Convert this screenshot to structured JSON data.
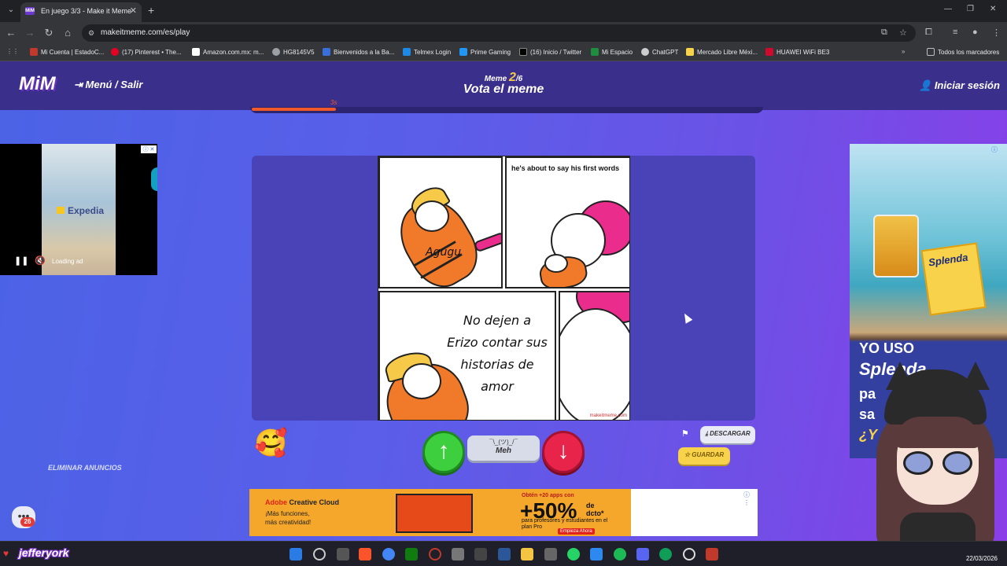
{
  "browser": {
    "tab_title": "En juego 3/3 - Make it Meme",
    "favicon_text": "MIM",
    "url": "makeitmeme.com/es/play",
    "bookmarks": [
      "Mi Cuenta | EstadoC...",
      "(17) Pinterest • The...",
      "Amazon.com.mx: m...",
      "HG8145V5",
      "Bienvenidos a la Ba...",
      "Telmex Login",
      "Prime Gaming",
      "(16) Inicio / Twitter",
      "Mi Espacio",
      "ChatGPT",
      "Mercado Libre Méxi...",
      "HUAWEI WiFi BE3"
    ],
    "all_bookmarks": "Todos los marcadores"
  },
  "site": {
    "logo": "MiM",
    "menu_label": "Menú / Salir",
    "meme_prefix": "Meme",
    "meme_current": "2",
    "meme_total": "/6",
    "title": "Vota el meme",
    "login_label": "Iniciar sesión",
    "timer_label": "3s",
    "timer_progress": 0.165,
    "remove_ads": "ELIMINAR ANUNCIOS",
    "chat_badge": "26"
  },
  "meme": {
    "top_caption": "he's about to say his first words",
    "speech": "Agugu",
    "main_caption": "No dejen a Erizo contar sus historias de amor",
    "watermark": "makeitmeme.com"
  },
  "vote": {
    "up_icon": "↑",
    "meh_face": "¯\\_(ツ)_/¯",
    "meh_label": "Meh",
    "down_icon": "↓",
    "download_label": "DESCARGAR",
    "save_label": "GUARDAR",
    "emoji": "🥰"
  },
  "ads": {
    "left_brand": "Expedia",
    "left_status": "Loading ad",
    "bottom_brand_a": "Adobe",
    "bottom_brand_b": " Creative Cloud",
    "bottom_tag_1": "¡Más funciones,",
    "bottom_tag_2": "más creatividad!",
    "bottom_promo_1": "Obtén +20 apps con",
    "bottom_big": "+50%",
    "bottom_de": "de dcto*",
    "bottom_promo_2": "para profesores y estudiantes en el plan Pro",
    "bottom_cta": "Empieza Ahora",
    "right_pack": "Splenda",
    "right_line1": "YO USO",
    "right_line2": "Splenda",
    "right_line3": "pa",
    "right_line4": "sa",
    "right_line5": "¿Y"
  },
  "stream": {
    "username": "jefferyork",
    "clock": "22/03/2026"
  },
  "colors": {
    "accent": "#f05a28",
    "upvote": "#3ecf3e",
    "downvote": "#e8244a",
    "save": "#f7d24a"
  }
}
